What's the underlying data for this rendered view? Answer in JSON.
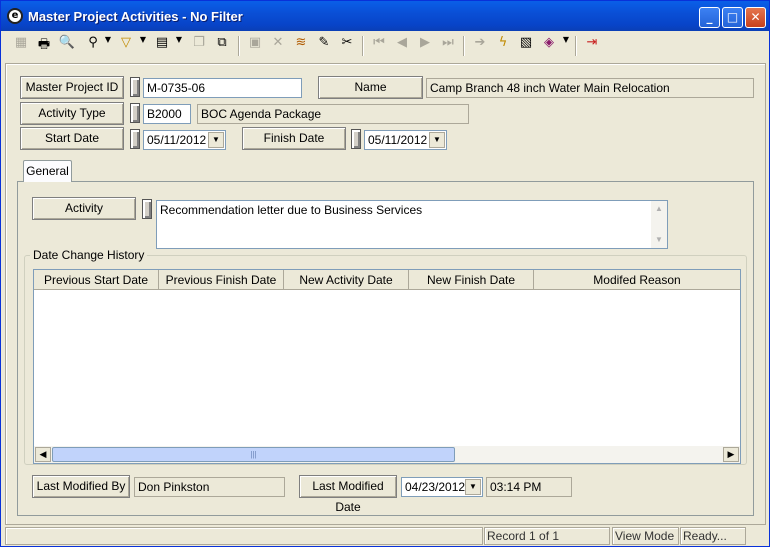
{
  "window": {
    "title": "Master Project Activities - No Filter",
    "app_icon": "app-logo-icon",
    "controls": [
      "minimize-icon",
      "maximize-icon",
      "close-icon"
    ]
  },
  "toolbar": {
    "icons": [
      "new-icon",
      "print-icon",
      "find-icon",
      "binoculars-icon",
      "filter-icon",
      "form-icon",
      "copy-icon",
      "paste-icon",
      "delete-record-icon",
      "cancel-icon",
      "stack-icon",
      "edit-pencil-icon",
      "cut-icon",
      "first-record-icon",
      "previous-record-icon",
      "next-record-icon",
      "last-record-icon",
      "go-icon",
      "lightning-icon",
      "layout-icon",
      "book-icon",
      "exit-icon"
    ]
  },
  "form": {
    "master_project_id_label": "Master Project ID",
    "master_project_id_value": "M-0735-06",
    "name_label": "Name",
    "name_value": "Camp Branch 48 inch Water Main Relocation",
    "activity_type_label": "Activity Type",
    "activity_type_code": "B2000",
    "activity_type_desc": "BOC Agenda Package",
    "start_date_label": "Start Date",
    "start_date_value": "05/11/2012",
    "finish_date_label": "Finish Date",
    "finish_date_value": "05/11/2012"
  },
  "tabs": {
    "general": "General"
  },
  "general": {
    "activity_label": "Activity",
    "activity_value": "Recommendation letter due to Business Services",
    "history_group_label": "Date Change History",
    "columns": [
      "Previous Start Date",
      "Previous Finish Date",
      "New Activity Date",
      "New Finish Date",
      "Modifed Reason"
    ],
    "rows": [],
    "last_modified_by_label": "Last Modified By",
    "last_modified_by_value": "Don Pinkston",
    "last_modified_date_label": "Last Modified Date",
    "last_modified_date_value": "04/23/2012",
    "last_modified_time_value": "03:14 PM"
  },
  "status": {
    "record": "Record 1 of 1",
    "mode": "View Mode",
    "state": "Ready..."
  }
}
